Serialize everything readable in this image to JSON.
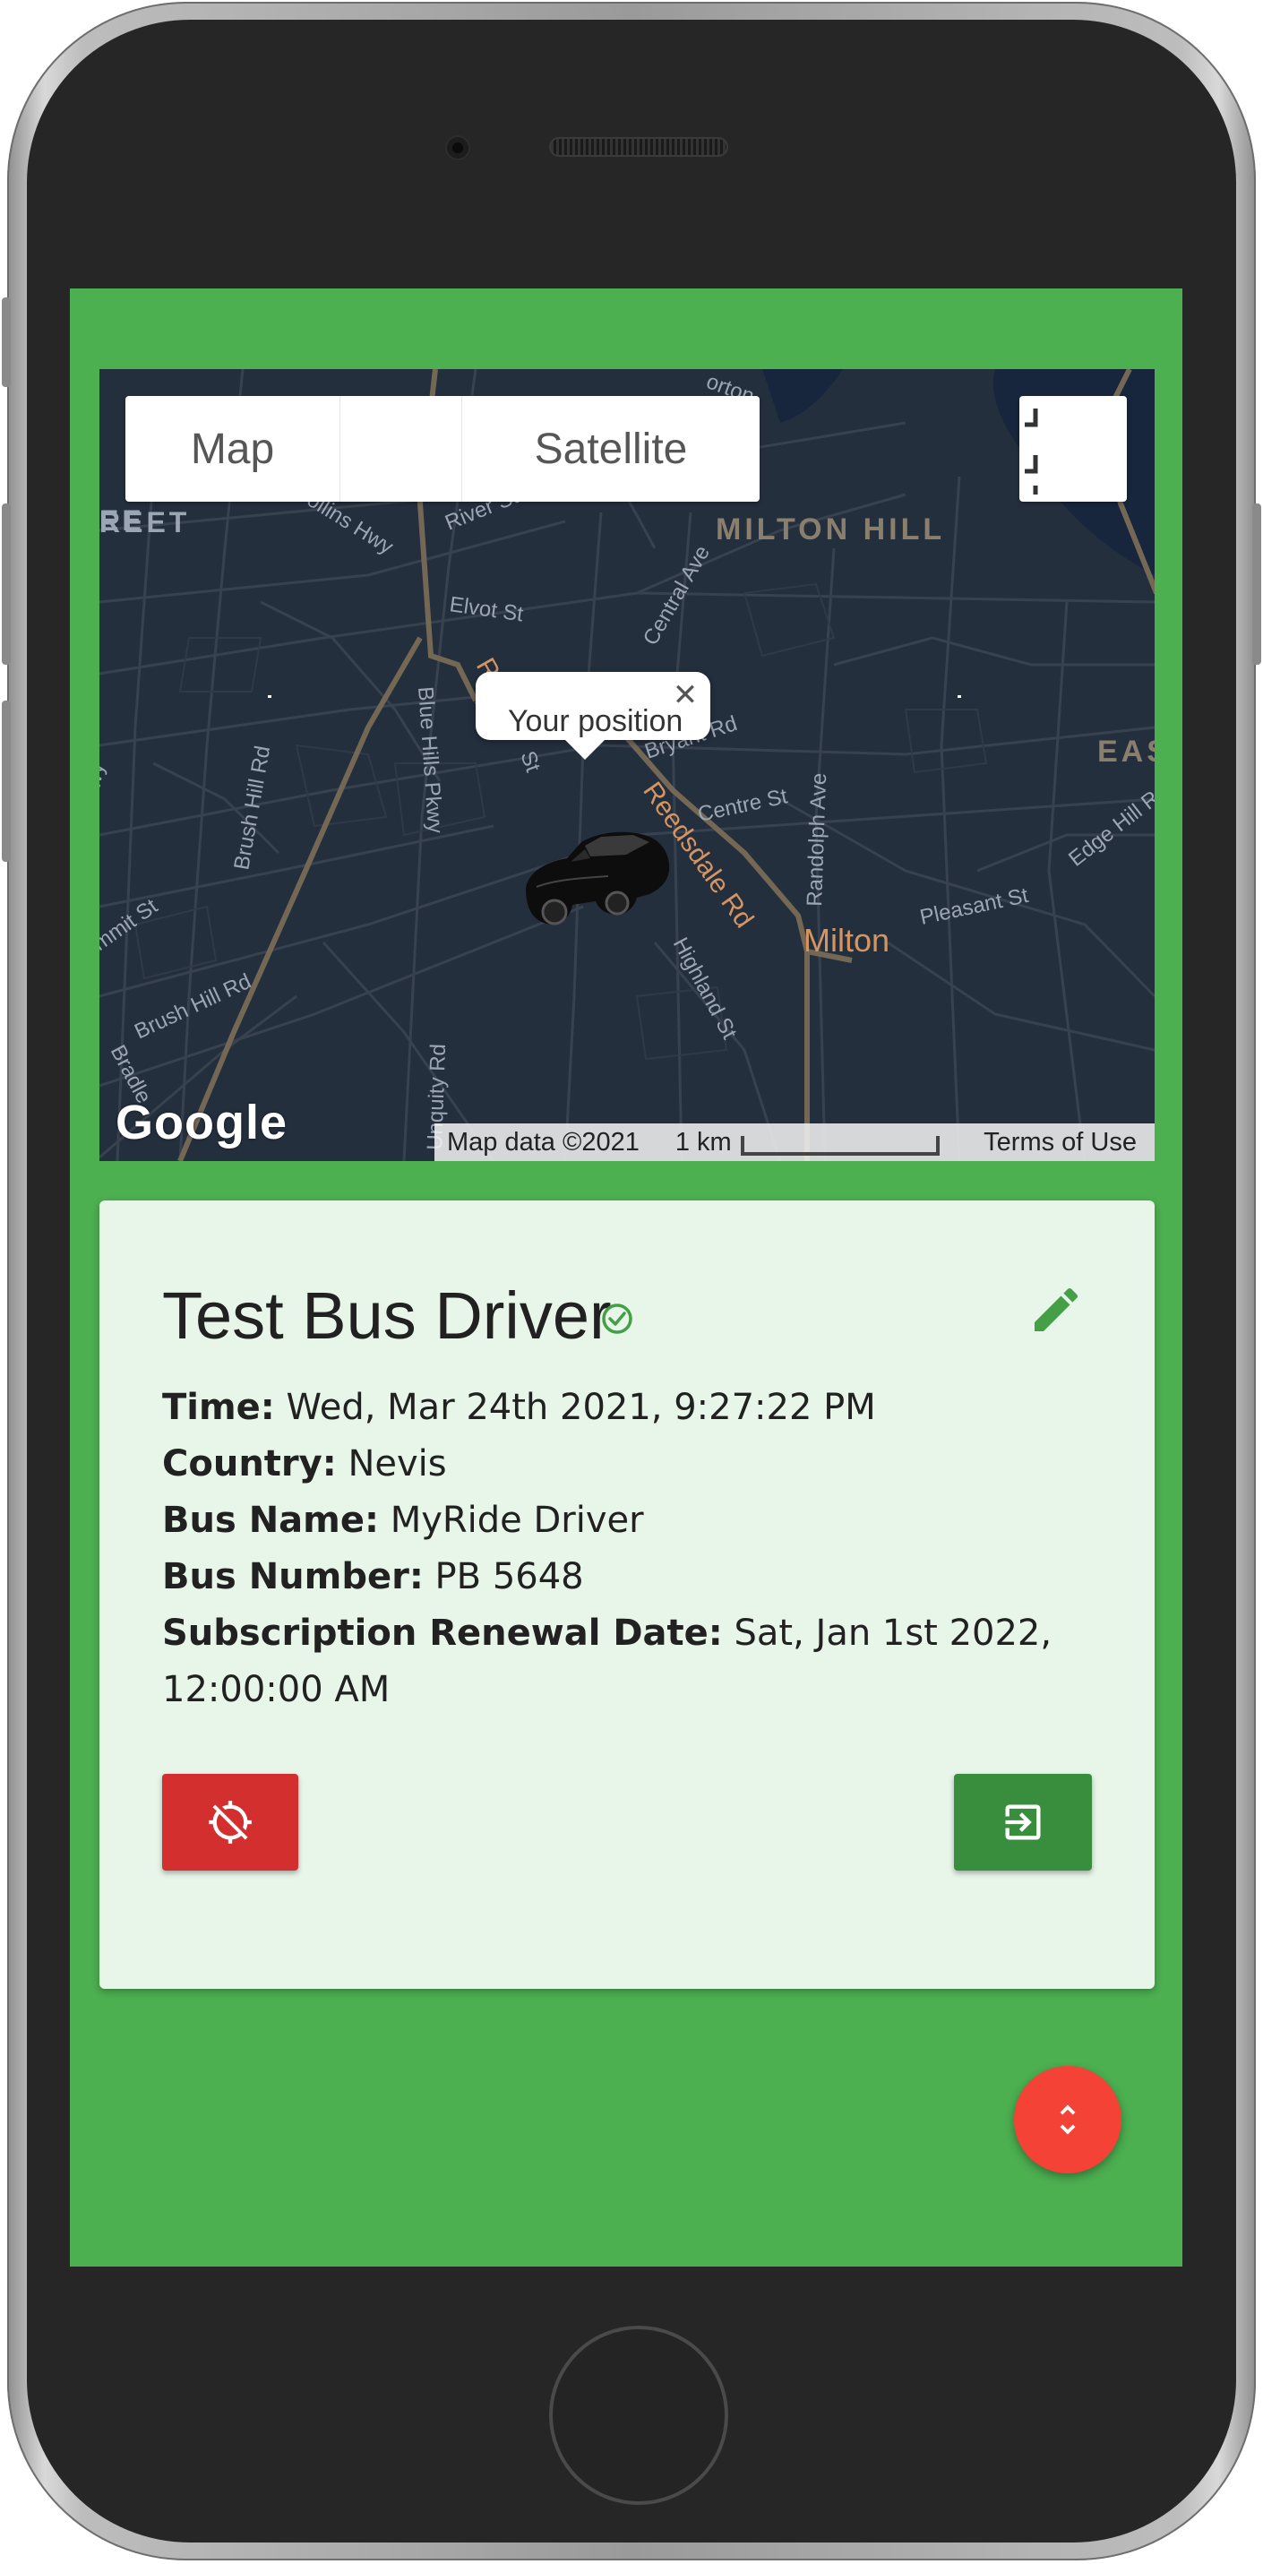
{
  "map": {
    "type_control": {
      "map_label": "Map",
      "satellite_label": "Satellite"
    },
    "labels": {
      "milton_hill": "MILTON HILL",
      "milton": "Milton",
      "reedsdale_rd": "Reedsdale Rd",
      "blue_hills_pkwy": "Blue Hills Pkwy",
      "brush_hill_rd": "Brush Hill Rd",
      "brush_hill_rd_2": "Brush Hill Rd",
      "centre_st": "Centre St",
      "randolph_ave": "Randolph Ave",
      "pleasant_st": "Pleasant St",
      "edge_hill_rd": "Edge Hill R",
      "highland_st": "Highland St",
      "central_ave": "Central Ave",
      "river_st": "River St",
      "elvot_st": "Elvot St",
      "unquity_rd": "Unquity Rd",
      "summit_st": "mmit St",
      "bradlee": "Bradle",
      "collins_hwy": "ollins Hwy",
      "eeet": "REET",
      "east": "EAS",
      "orton": "orton",
      "bryant_rd": "Bryant Rd",
      "r_fragment": "R",
      "st_fragment": "St",
      "wy_fragment": "wy",
      "ee_fragment": "EE"
    },
    "info_window": {
      "text": "Your position",
      "close_glyph": "✕"
    },
    "google_logo": "Google",
    "attribution": {
      "map_data": "Map data ©2021",
      "scale": "1 km",
      "terms": "Terms of Use"
    },
    "colors": {
      "background": "#242f3e",
      "road": "#38414e",
      "highway": "#746855",
      "water": "#17263c",
      "label": "#d59563"
    }
  },
  "driver": {
    "name": "Test Bus Driver",
    "verified_icon": "check-circle-outline-icon",
    "edit_icon": "pencil-icon",
    "details": [
      {
        "label": "Time:",
        "value": "Wed, Mar 24th 2021, 9:27:22 PM"
      },
      {
        "label": "Country:",
        "value": "Nevis"
      },
      {
        "label": "Bus Name:",
        "value": "MyRide Driver"
      },
      {
        "label": "Bus Number:",
        "value": "PB 5648"
      },
      {
        "label": "Subscription Renewal Date:",
        "value": "Sat, Jan 1st 2022, 12:00:00 AM"
      }
    ]
  },
  "actions": {
    "stop_tracking_icon": "location-disabled-icon",
    "logout_icon": "exit-to-app-icon",
    "fab_icon": "unfold-more-icon"
  },
  "colors": {
    "screen_bg": "#4caf50",
    "card_bg": "#e8f5e9",
    "stop_button": "#d32f2f",
    "logout_button": "#388e3c",
    "fab": "#f44336",
    "accent_green": "#43a047"
  }
}
